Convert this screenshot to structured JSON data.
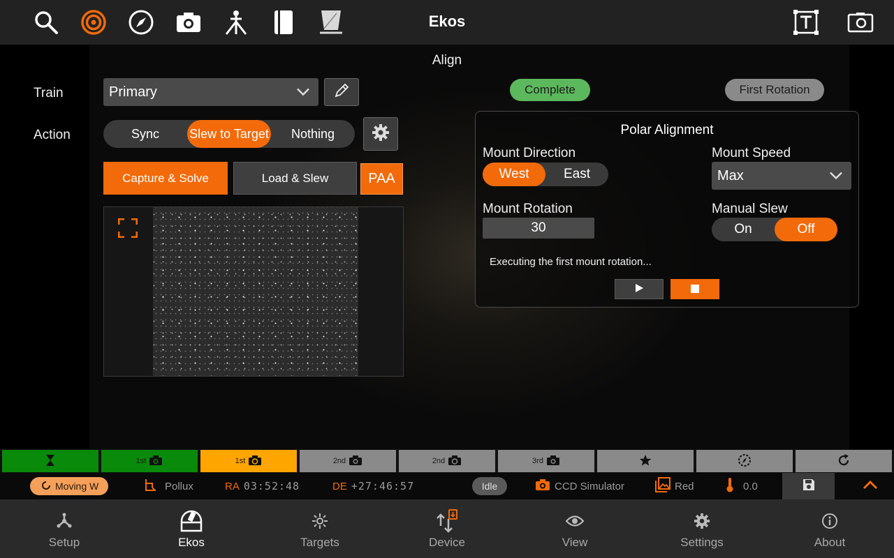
{
  "header": {
    "title": "Ekos"
  },
  "align": {
    "title": "Align",
    "train_label": "Train",
    "train_value": "Primary",
    "action_label": "Action",
    "actions": [
      "Sync",
      "Slew to Target",
      "Nothing"
    ],
    "active_action": "Slew to Target",
    "capture_solve": "Capture & Solve",
    "load_slew": "Load & Slew",
    "paa": "PAA",
    "status_complete": "Complete",
    "status_stage": "First Rotation"
  },
  "polar": {
    "title": "Polar Alignment",
    "mount_direction_label": "Mount Direction",
    "direction_options": [
      "West",
      "East"
    ],
    "direction_selected": "West",
    "mount_speed_label": "Mount Speed",
    "mount_speed_value": "Max",
    "mount_rotation_label": "Mount Rotation",
    "mount_rotation_value": "30",
    "manual_slew_label": "Manual Slew",
    "manual_slew_options": [
      "On",
      "Off"
    ],
    "manual_slew_selected": "Off",
    "status_text": "Executing the first mount rotation..."
  },
  "steps": [
    {
      "label": "",
      "icon": "hourglass-icon",
      "color": "#0a8a0a"
    },
    {
      "label": "1st",
      "icon": "camera-icon",
      "color": "#0a8a0a"
    },
    {
      "label": "1st",
      "icon": "camera-rotate-icon",
      "color": "#ffa500"
    },
    {
      "label": "2nd",
      "icon": "camera-icon",
      "color": "#8a8a8a"
    },
    {
      "label": "2nd",
      "icon": "camera-rotate-icon",
      "color": "#8a8a8a"
    },
    {
      "label": "3rd",
      "icon": "camera-icon",
      "color": "#8a8a8a"
    },
    {
      "label": "",
      "icon": "star-icon",
      "color": "#8a8a8a"
    },
    {
      "label": "",
      "icon": "compass-dashed-icon",
      "color": "#8a8a8a"
    },
    {
      "label": "",
      "icon": "refresh-icon",
      "color": "#8a8a8a"
    }
  ],
  "status": {
    "mount_state": "Moving W",
    "target": "Pollux",
    "ra_label": "RA",
    "ra_value": "03:52:48",
    "de_label": "DE",
    "de_value": "+27:46:57",
    "capture_state": "Idle",
    "camera": "CCD Simulator",
    "filter": "Red",
    "temperature": "0.0"
  },
  "nav": {
    "items": [
      "Setup",
      "Ekos",
      "Targets",
      "Device",
      "View",
      "Settings",
      "About"
    ],
    "active": "Ekos"
  },
  "colors": {
    "accent": "#f26a0a",
    "complete": "#5cb85c",
    "done_step": "#0a8a0a",
    "active_step": "#ffa500"
  }
}
